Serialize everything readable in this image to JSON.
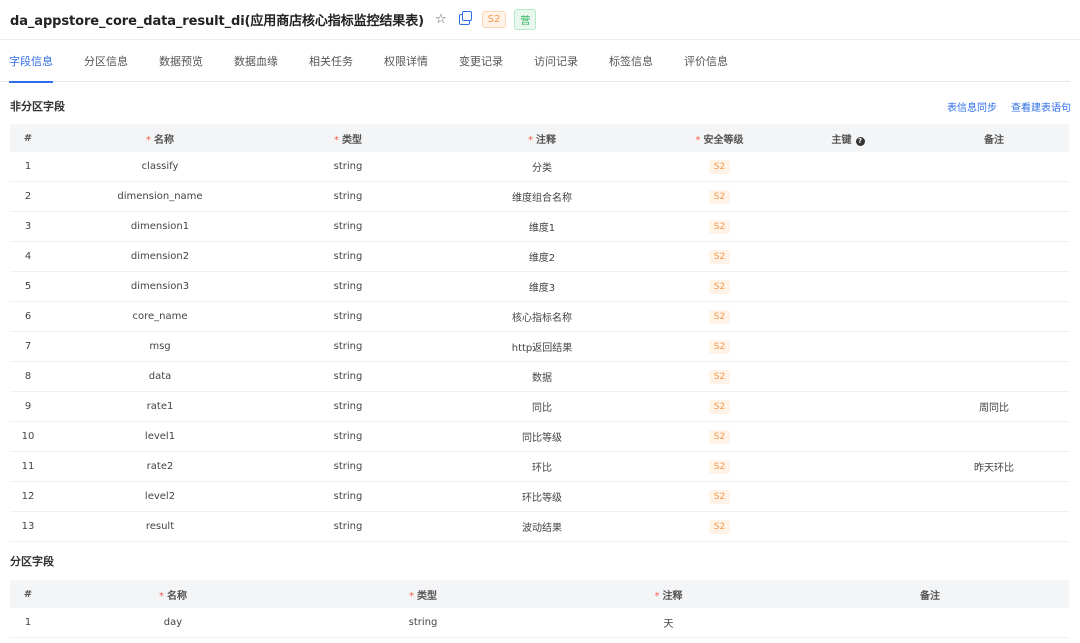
{
  "header": {
    "title": "da_appstore_core_data_result_di(应用商店核心指标监控结果表)",
    "star_icon": "☆",
    "security_tag": "S2",
    "status_tag": "营"
  },
  "tabs": [
    {
      "label": "字段信息",
      "active": true
    },
    {
      "label": "分区信息"
    },
    {
      "label": "数据预览"
    },
    {
      "label": "数据血缘"
    },
    {
      "label": "相关任务"
    },
    {
      "label": "权限详情"
    },
    {
      "label": "变更记录"
    },
    {
      "label": "访问记录"
    },
    {
      "label": "标签信息"
    },
    {
      "label": "评价信息"
    }
  ],
  "non_partition": {
    "title": "非分区字段",
    "sync_link": "表信息同步",
    "ddl_link": "查看建表语句",
    "columns": [
      "#",
      "名称",
      "类型",
      "注释",
      "安全等级",
      "主键",
      "备注"
    ],
    "rows": [
      [
        "1",
        "classify",
        "string",
        "分类",
        "S2",
        "",
        ""
      ],
      [
        "2",
        "dimension_name",
        "string",
        "维度组合名称",
        "S2",
        "",
        ""
      ],
      [
        "3",
        "dimension1",
        "string",
        "维度1",
        "S2",
        "",
        ""
      ],
      [
        "4",
        "dimension2",
        "string",
        "维度2",
        "S2",
        "",
        ""
      ],
      [
        "5",
        "dimension3",
        "string",
        "维度3",
        "S2",
        "",
        ""
      ],
      [
        "6",
        "core_name",
        "string",
        "核心指标名称",
        "S2",
        "",
        ""
      ],
      [
        "7",
        "msg",
        "string",
        "http返回结果",
        "S2",
        "",
        ""
      ],
      [
        "8",
        "data",
        "string",
        "数据",
        "S2",
        "",
        ""
      ],
      [
        "9",
        "rate1",
        "string",
        "同比",
        "S2",
        "",
        "周同比"
      ],
      [
        "10",
        "level1",
        "string",
        "同比等级",
        "S2",
        "",
        ""
      ],
      [
        "11",
        "rate2",
        "string",
        "环比",
        "S2",
        "",
        "昨天环比"
      ],
      [
        "12",
        "level2",
        "string",
        "环比等级",
        "S2",
        "",
        ""
      ],
      [
        "13",
        "result",
        "string",
        "波动结果",
        "S2",
        "",
        ""
      ]
    ]
  },
  "partition": {
    "title": "分区字段",
    "columns": [
      "#",
      "名称",
      "类型",
      "注释",
      "备注"
    ],
    "rows": [
      [
        "1",
        "day",
        "string",
        "天",
        ""
      ]
    ]
  }
}
